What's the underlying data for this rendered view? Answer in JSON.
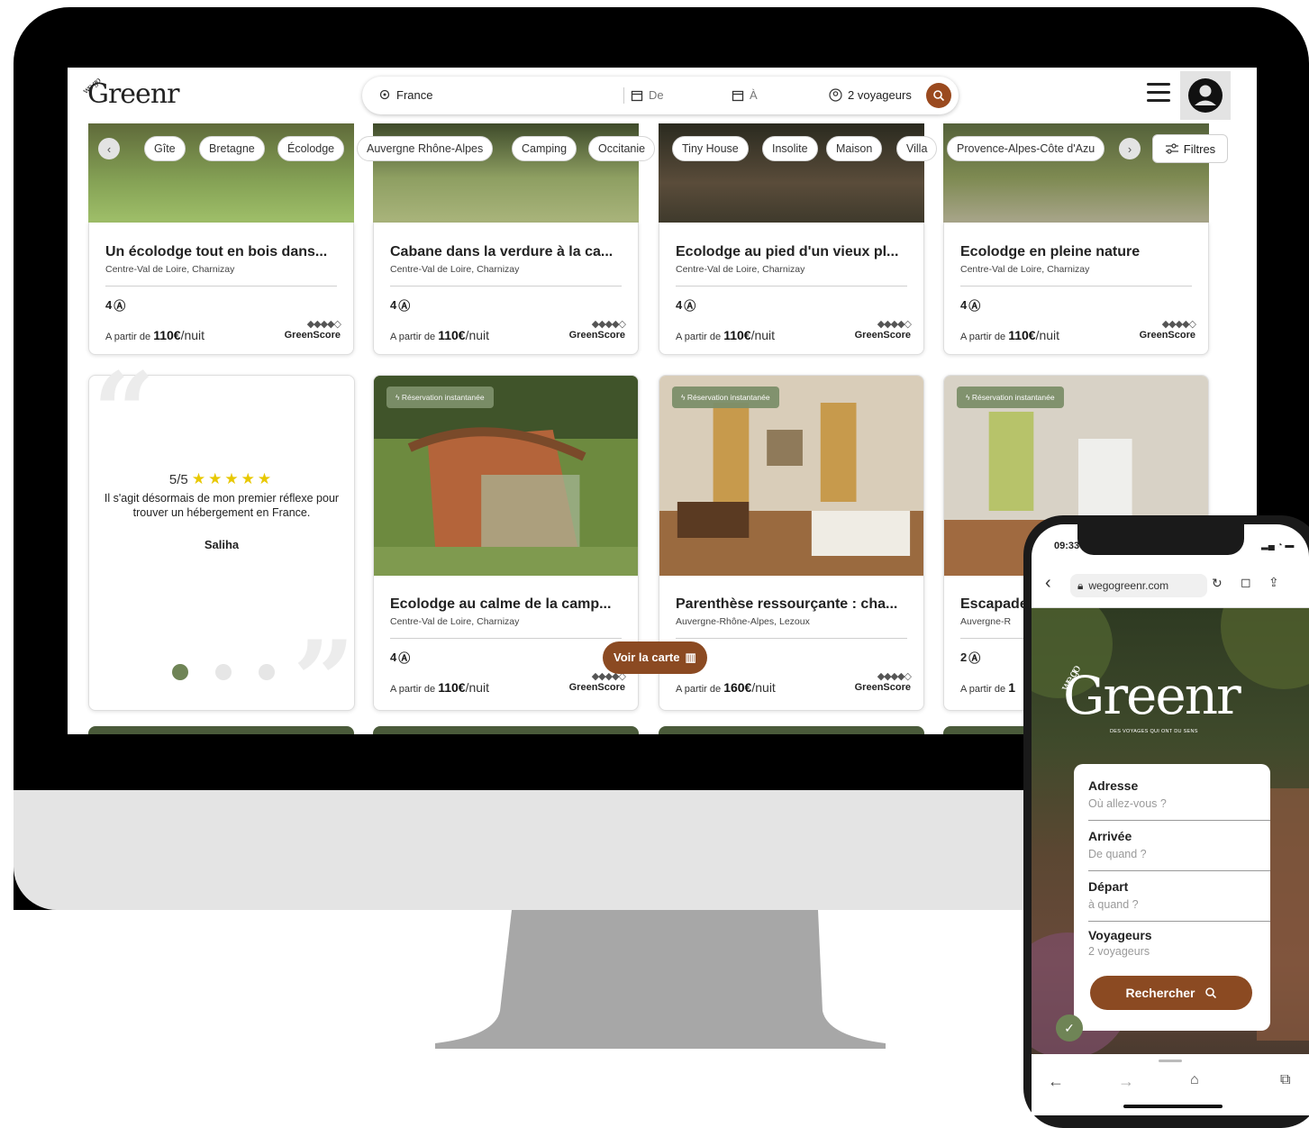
{
  "site": {
    "logo": "Greenr",
    "logo_prefix": "we go"
  },
  "search": {
    "location": "France",
    "from": "De",
    "to": "À",
    "travelers": "2 voyageurs"
  },
  "chips": [
    "Gîte",
    "Bretagne",
    "Écolodge",
    "Auvergne Rhône-Alpes",
    "Camping",
    "Occitanie",
    "Tiny House",
    "Insolite",
    "Maison",
    "Villa",
    "Provence-Alpes-Côte d'Azu"
  ],
  "filters_label": "Filtres",
  "row1": [
    {
      "title": "Un écolodge tout en bois dans...",
      "location": "Centre-Val de Loire, Charnizay",
      "guests": "4",
      "price_prefix": "A partir de",
      "price": "110€",
      "price_unit": "/nuit",
      "score_label": "GreenScore"
    },
    {
      "title": "Cabane dans la verdure à la ca...",
      "location": "Centre-Val de Loire, Charnizay",
      "guests": "4",
      "price_prefix": "A partir de",
      "price": "110€",
      "price_unit": "/nuit",
      "score_label": "GreenScore"
    },
    {
      "title": "Ecolodge au pied d'un vieux pl...",
      "location": "Centre-Val de Loire, Charnizay",
      "guests": "4",
      "price_prefix": "A partir de",
      "price": "110€",
      "price_unit": "/nuit",
      "score_label": "GreenScore"
    },
    {
      "title": "Ecolodge en pleine nature",
      "location": "Centre-Val de Loire, Charnizay",
      "guests": "4",
      "price_prefix": "A partir de",
      "price": "110€",
      "price_unit": "/nuit",
      "score_label": "GreenScore"
    }
  ],
  "review": {
    "rating": "5/5",
    "stars": "★★★★★",
    "text": "Il s'agit désormais de mon premier réflexe pour trouver un hébergement en France.",
    "author": "Saliha"
  },
  "row2": [
    {
      "badge": "Réservation instantanée",
      "title": "Ecolodge au calme de la camp...",
      "location": "Centre-Val de Loire, Charnizay",
      "guests": "4",
      "price_prefix": "A partir de",
      "price": "110€",
      "price_unit": "/nuit",
      "score_label": "GreenScore"
    },
    {
      "badge": "Réservation instantanée",
      "title": "Parenthèse ressourçante : cha...",
      "location": "Auvergne-Rhône-Alpes, Lezoux",
      "guests": "",
      "price_prefix": "A partir de",
      "price": "160€",
      "price_unit": "/nuit",
      "score_label": "GreenScore"
    },
    {
      "badge": "Réservation instantanée",
      "title": "Escapade",
      "location": "Auvergne-R",
      "guests": "2",
      "price_prefix": "A partir de",
      "price": "1",
      "price_unit": "",
      "score_label": ""
    }
  ],
  "map_button": "Voir la carte",
  "phone": {
    "time": "09:33",
    "url": "wegogreenr.com",
    "logo": "Greenr",
    "logo_prefix": "we go",
    "tagline": "DES VOYAGES QUI ONT DU SENS",
    "fields": [
      {
        "label": "Adresse",
        "placeholder": "Où allez-vous ?"
      },
      {
        "label": "Arrivée",
        "placeholder": "De quand ?"
      },
      {
        "label": "Départ",
        "placeholder": "à quand ?"
      },
      {
        "label": "Voyageurs",
        "placeholder": "2 voyageurs"
      }
    ],
    "search_button": "Rechercher"
  },
  "colors": {
    "accent": "#8b4a22",
    "green": "#6f8456",
    "badge": "#7d8f6a"
  }
}
